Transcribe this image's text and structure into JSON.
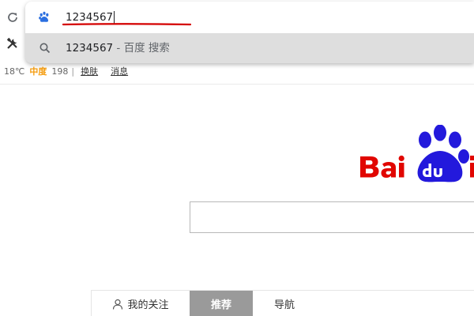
{
  "omnibox": {
    "input_value": "1234567",
    "suggestion_query": "1234567",
    "suggestion_suffix": "- 百度 搜索"
  },
  "header": {
    "temperature": "18℃",
    "aqi_label": "中度",
    "aqi_value": "198",
    "separator": "|",
    "links": [
      "换肤",
      "消息"
    ]
  },
  "tabs": {
    "follow": "我的关注",
    "recommend": "推荐",
    "nav": "导航"
  },
  "search": {
    "value": ""
  },
  "colors": {
    "baidu_red": "#e10601",
    "baidu_blue": "#2319dc",
    "aqi_orange": "#f49b0c",
    "active_tab": "#9a9a9a"
  },
  "icons": [
    "reload-icon",
    "tools-icon",
    "baidu-paw-icon",
    "search-icon",
    "person-icon"
  ]
}
